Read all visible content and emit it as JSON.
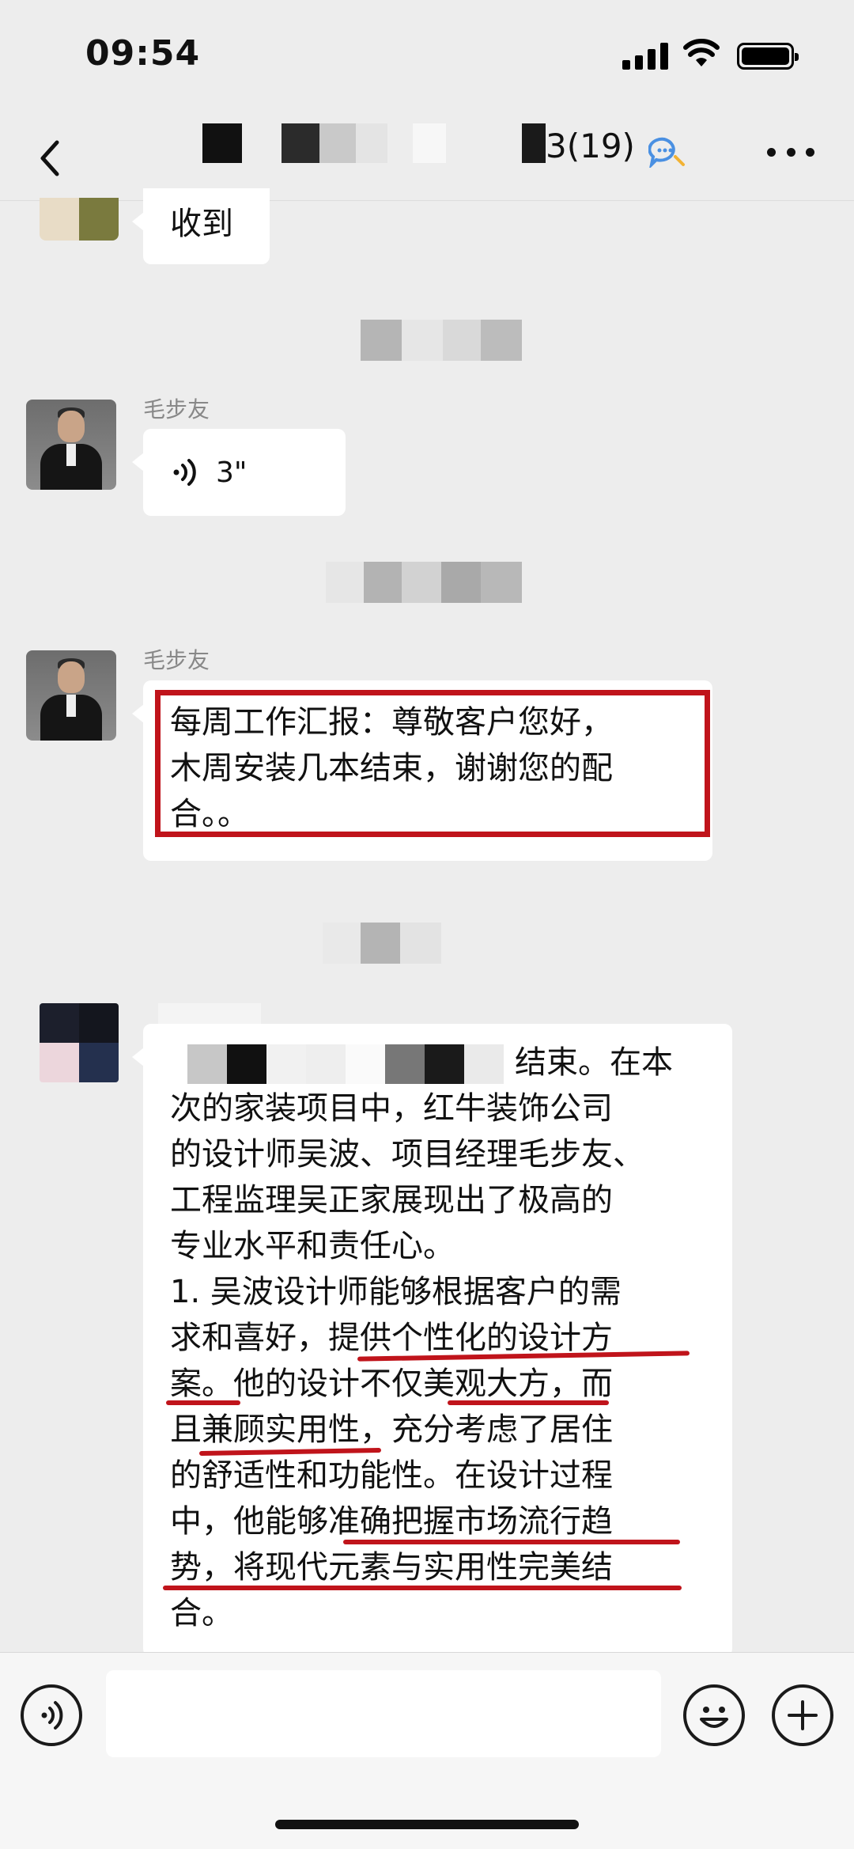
{
  "status": {
    "time": "09:54"
  },
  "nav": {
    "title_suffix": "3(19)",
    "back_icon": "chevron-left-icon",
    "chat_icon": "group-chat-icon",
    "more_icon": "more-dots-icon"
  },
  "messages": [
    {
      "type": "text",
      "text": "收到"
    },
    {
      "type": "voice",
      "sender": "毛步友",
      "duration": "3\""
    },
    {
      "type": "text",
      "sender": "毛步友",
      "text": "每周工作汇报：尊敬客户您好，\n木周安装几本结束，谢谢您的配\n合。。"
    },
    {
      "type": "text",
      "text_end_first_line": "结束。在本",
      "text": "次的家装项目中，红牛装饰公司\n的设计师吴波、项目经理毛步友、\n工程监理吴正家展现出了极高的\n专业水平和责任心。\n1. 吴波设计师能够根据客户的需\n求和喜好，提供个性化的设计方\n案。他的设计不仅美观大方，而\n且兼顾实用性，充分考虑了居住\n的舒适性和功能性。在设计过程\n中，他能够准确把握市场流行趋\n势，将现代元素与实用性完美结\n合。"
    }
  ],
  "input_bar": {
    "voice_icon": "voice-input-icon",
    "emoji_icon": "emoji-icon",
    "plus_icon": "plus-icon"
  },
  "colors": {
    "background": "#ededed",
    "annotation_red": "#c0141b",
    "bubble": "#ffffff"
  }
}
